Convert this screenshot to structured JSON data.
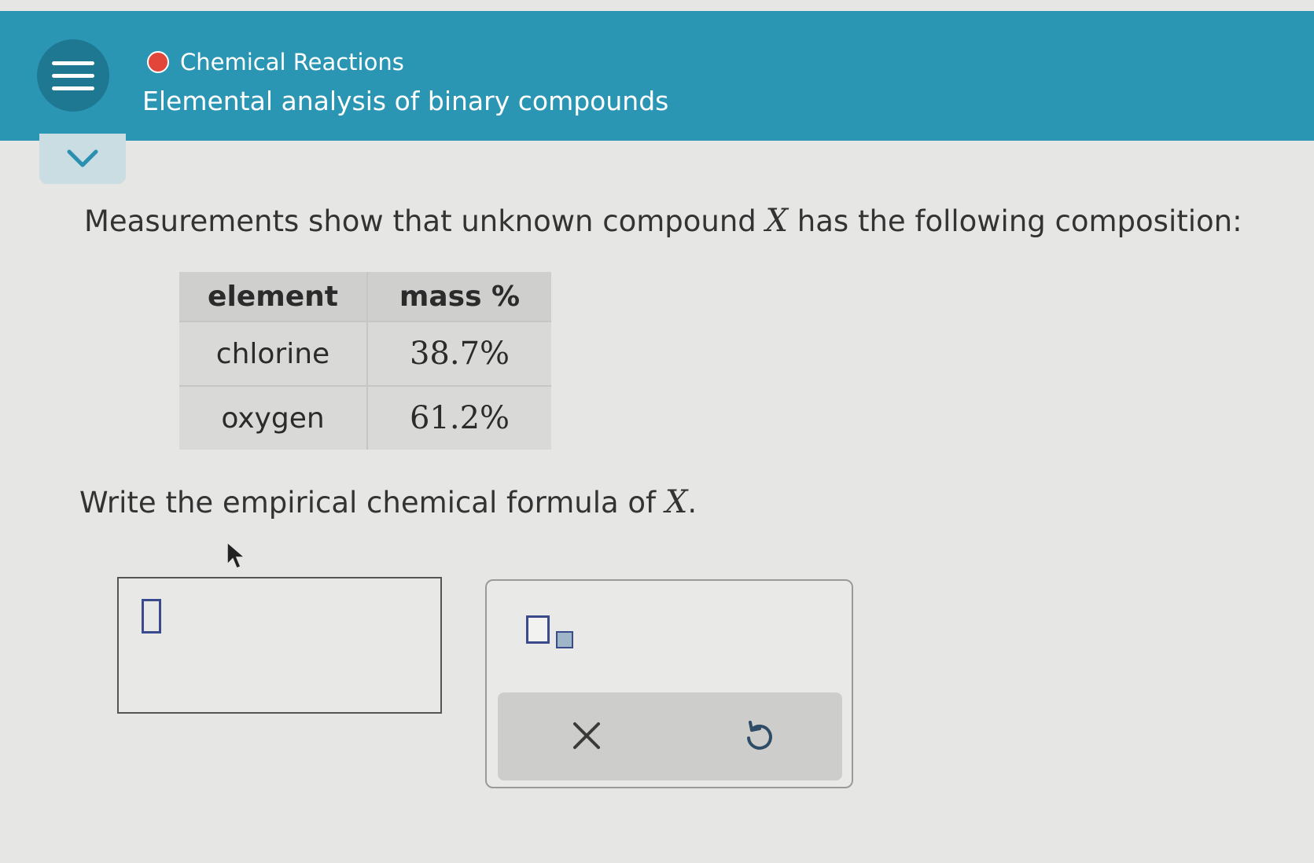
{
  "header": {
    "topic": "Chemical Reactions",
    "subtitle": "Elemental analysis of binary compounds",
    "brand_color": "#2a96b4",
    "status_dot_color": "#e2463a"
  },
  "question": {
    "intro": "Measurements show that unknown compound ",
    "variable": "X",
    "outro": " has the following composition:",
    "table": {
      "headers": [
        "element",
        "mass %"
      ],
      "rows": [
        [
          "chlorine",
          "38.7%"
        ],
        [
          "oxygen",
          "61.2%"
        ]
      ]
    },
    "instruction": "Write the empirical chemical formula of ",
    "instruction_variable": "X",
    "instruction_end": "."
  },
  "icons": {
    "menu": "hamburger-menu-icon",
    "collapse": "chevron-down-icon",
    "subscript": "subscript-template-icon",
    "clear": "close-icon",
    "undo": "undo-icon"
  }
}
